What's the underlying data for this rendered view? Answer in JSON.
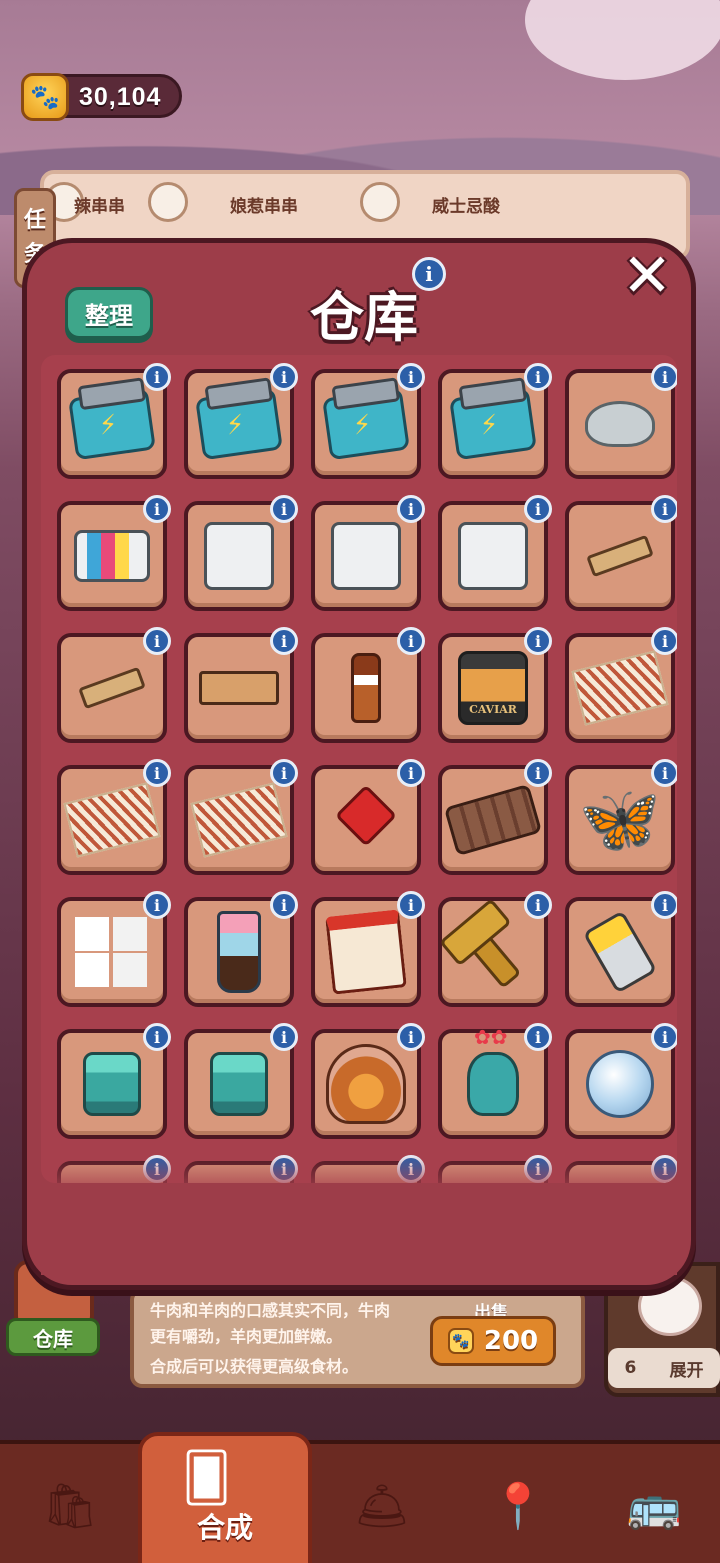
{
  "currency": {
    "amount": "30,104",
    "icon": "paw-coin-icon"
  },
  "orders_behind": [
    {
      "label": "辣串串",
      "icon": "skewer-icon"
    },
    {
      "label": "娘惹串串",
      "icon": "bowl-icon"
    },
    {
      "label": "威士忌酸",
      "icon": "cup-icon"
    }
  ],
  "task_tab": {
    "line1": "任",
    "line2": "务"
  },
  "modal": {
    "title": "仓库",
    "sort_label": "整理",
    "info_icon": "i",
    "close_icon": "✕"
  },
  "slots": [
    {
      "item": "battery-box",
      "cls": "battery"
    },
    {
      "item": "battery-box",
      "cls": "battery"
    },
    {
      "item": "battery-box",
      "cls": "battery"
    },
    {
      "item": "battery-box",
      "cls": "battery"
    },
    {
      "item": "ceramic-pot",
      "cls": "pot"
    },
    {
      "item": "ink-cartridges",
      "cls": "printer-ink"
    },
    {
      "item": "printer",
      "cls": "printer"
    },
    {
      "item": "printer",
      "cls": "printer"
    },
    {
      "item": "printer",
      "cls": "printer"
    },
    {
      "item": "wood-clamp",
      "cls": "clamp"
    },
    {
      "item": "wood-clamps",
      "cls": "clamp"
    },
    {
      "item": "bottle-rack",
      "cls": "rack"
    },
    {
      "item": "sauce-bottle",
      "cls": "bottle"
    },
    {
      "item": "caviar-jar",
      "cls": "jar",
      "text": "CAVIAR"
    },
    {
      "item": "dried-jerky",
      "cls": "jerky"
    },
    {
      "item": "dried-jerky",
      "cls": "jerky"
    },
    {
      "item": "dried-jerky",
      "cls": "jerky"
    },
    {
      "item": "chinese-knot",
      "cls": "knot"
    },
    {
      "item": "wooden-sled",
      "cls": "sled"
    },
    {
      "item": "purple-butterfly",
      "cls": "butterfly",
      "text": "🦋"
    },
    {
      "item": "sugar-cubes",
      "cls": "sugar"
    },
    {
      "item": "layered-drink",
      "cls": "drink"
    },
    {
      "item": "red-scroll",
      "cls": "scroll"
    },
    {
      "item": "wooden-mallet",
      "cls": "hammer"
    },
    {
      "item": "yellow-saw",
      "cls": "saw"
    },
    {
      "item": "teal-canister",
      "cls": "can"
    },
    {
      "item": "teal-canister",
      "cls": "can"
    },
    {
      "item": "fruit-basket",
      "cls": "basket"
    },
    {
      "item": "flower-vase",
      "cls": "vase"
    },
    {
      "item": "crystal-ball",
      "cls": "crystal"
    },
    {
      "item": "partial-item",
      "cls": ""
    },
    {
      "item": "partial-item",
      "cls": ""
    },
    {
      "item": "partial-item",
      "cls": ""
    },
    {
      "item": "partial-item",
      "cls": ""
    },
    {
      "item": "partial-item",
      "cls": ""
    }
  ],
  "item_description": {
    "line1": "牛肉和羊肉的口感其实不同，牛肉",
    "line2": "更有嚼劲，羊肉更加鲜嫩。",
    "line3": "合成后可以获得更高级食材。"
  },
  "sell": {
    "label": "出售",
    "price": "200"
  },
  "warehouse_button": {
    "label": "仓库"
  },
  "expand_panel": {
    "count": "6",
    "label": "展开"
  },
  "bottom_nav": {
    "active_label": "合成",
    "items": [
      {
        "icon": "shop-bag-icon"
      },
      {
        "icon": "merge-cards-icon"
      },
      {
        "icon": "service-bell-icon"
      },
      {
        "icon": "map-pin-icon"
      },
      {
        "icon": "bus-icon"
      }
    ]
  },
  "colors": {
    "panel": "#9d3d49",
    "slot": "#d8987c",
    "info_badge": "#2c5fa8",
    "sort_button": "#3ea68a",
    "sell_button": "#e0872a"
  }
}
